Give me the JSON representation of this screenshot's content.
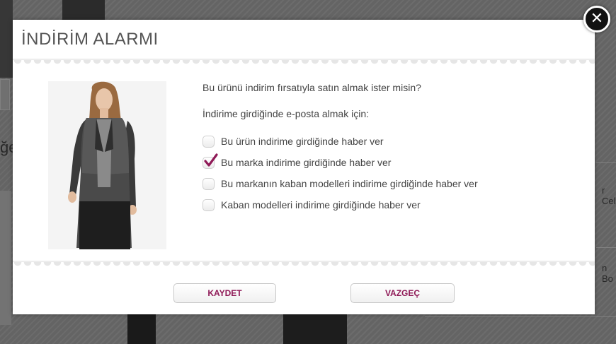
{
  "background": {
    "fragments": [
      "ğe",
      "r Cel",
      "n Bo"
    ]
  },
  "modal": {
    "title": "İNDİRİM ALARMI",
    "question": "Bu ürünü indirim fırsatıyla satın almak ister misin?",
    "subtitle": "İndirime girdiğinde e-posta almak için:",
    "options": [
      {
        "label": "Bu ürün indirime girdiğinde haber ver",
        "checked": false
      },
      {
        "label": "Bu marka indirime girdiğinde haber ver",
        "checked": true
      },
      {
        "label": "Bu markanın kaban modelleri indirime girdiğinde haber ver",
        "checked": false
      },
      {
        "label": "Kaban modelleri indirime girdiğinde haber ver",
        "checked": false
      }
    ],
    "buttons": {
      "save": "KAYDET",
      "cancel": "VAZGEÇ"
    },
    "close_icon": "close-icon"
  },
  "colors": {
    "accent": "#8f1a57",
    "check": "#8f1a57"
  }
}
